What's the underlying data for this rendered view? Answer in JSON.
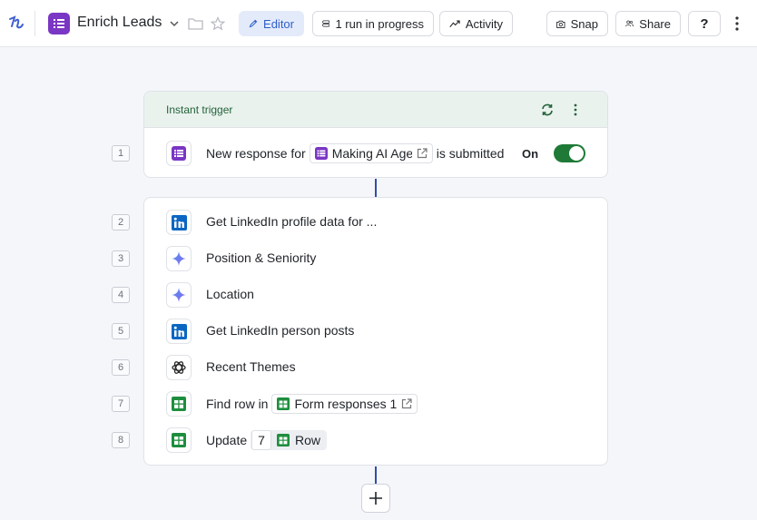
{
  "header": {
    "title": "Enrich Leads",
    "editor_label": "Editor",
    "runs_label": "1 run in progress",
    "activity_label": "Activity",
    "snap_label": "Snap",
    "share_label": "Share",
    "help_label": "?"
  },
  "trigger": {
    "section_label": "Instant trigger",
    "step_number": "1",
    "text_before": "New response for",
    "form_name": "Making AI Age",
    "text_after": "is submitted",
    "toggle_label": "On",
    "toggle_on": true
  },
  "steps": [
    {
      "number": "2",
      "icon": "linkedin-icon",
      "text": "Get LinkedIn profile data for ..."
    },
    {
      "number": "3",
      "icon": "sparkle-icon",
      "text": "Position & Seniority"
    },
    {
      "number": "4",
      "icon": "sparkle-icon",
      "text": "Location"
    },
    {
      "number": "5",
      "icon": "linkedin-icon",
      "text": "Get LinkedIn person posts"
    },
    {
      "number": "6",
      "icon": "openai-icon",
      "text": "Recent Themes"
    },
    {
      "number": "7",
      "icon": "google-sheets-icon",
      "text": "Find row in",
      "chip": "Form responses 1"
    },
    {
      "number": "8",
      "icon": "google-sheets-icon",
      "text": "Update",
      "chip_num": "7",
      "chip": "Row"
    }
  ],
  "colors": {
    "accent": "#2f5ec9",
    "trigger_green": "#23633a",
    "toggle_green": "#1e7a36",
    "forms_purple": "#7a36c4",
    "linkedin_blue": "#0a66c2",
    "sheets_green": "#1e8e3e"
  }
}
